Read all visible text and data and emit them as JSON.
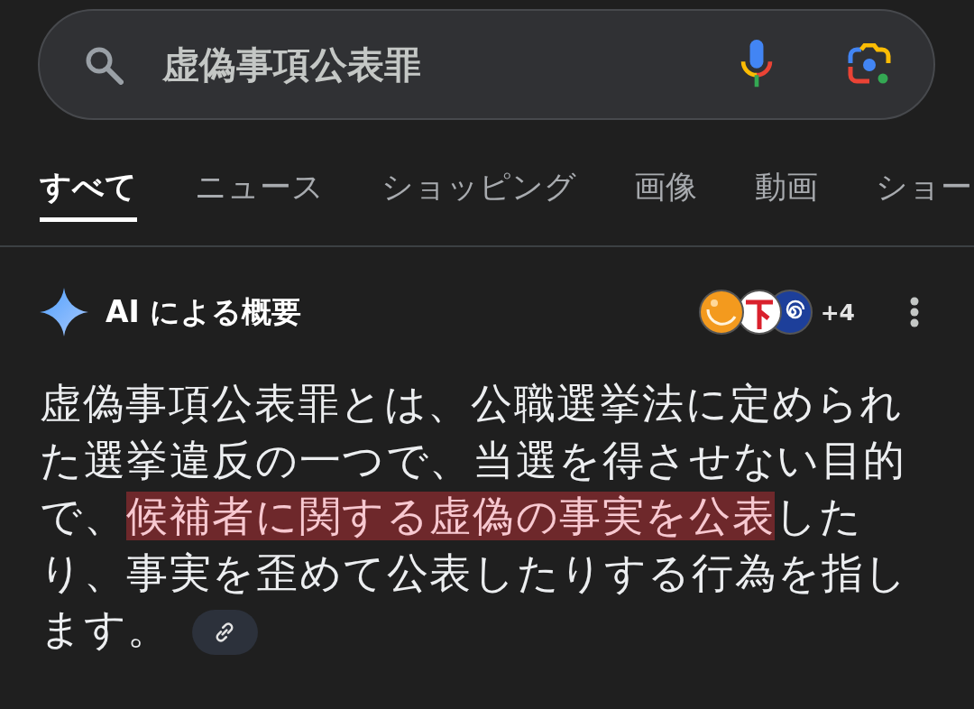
{
  "search": {
    "value": "虚偽事項公表罪"
  },
  "tabs": [
    {
      "label": "すべて",
      "selected": true
    },
    {
      "label": "ニュース",
      "selected": false
    },
    {
      "label": "ショッピング",
      "selected": false
    },
    {
      "label": "画像",
      "selected": false
    },
    {
      "label": "動画",
      "selected": false
    },
    {
      "label": "ショー",
      "selected": false
    }
  ],
  "ai_overview": {
    "title": "AI による概要",
    "sources_more": "+4",
    "summary": [
      {
        "text": "虚偽事項公表罪とは、公職選挙法に定められた選挙違反の一つで、当選を得させない目的で、",
        "highlighted": false
      },
      {
        "text": "候補者に関する虚偽の事実を公表",
        "highlighted": true
      },
      {
        "text": "したり、事実を歪めて公表したりする行為を指します。",
        "highlighted": false
      }
    ]
  }
}
